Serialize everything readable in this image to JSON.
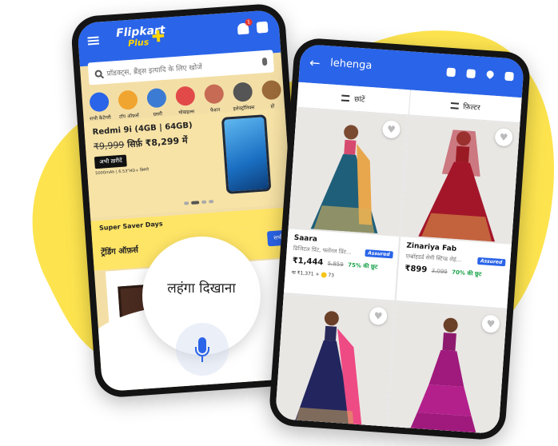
{
  "colors": {
    "brand_blue": "#2a64e8",
    "yellow_blob": "#fde44f",
    "discount_green": "#1aa34a"
  },
  "left_phone": {
    "logo": {
      "line1": "Flipkart",
      "line2": "Plus"
    },
    "search_placeholder": "प्रॉडक्ट्स, ब्रैंड्स इत्यादि के लिए खोजें",
    "categories": [
      {
        "label": "सभी कैटेगरी",
        "color": "#2a64e8"
      },
      {
        "label": "टॉप ऑफ़र्स",
        "color": "#f0a531"
      },
      {
        "label": "ग्रसरी",
        "color": "#3b7bd4"
      },
      {
        "label": "मोबाइल्स",
        "color": "#e24a4a"
      },
      {
        "label": "फैशन",
        "color": "#c76b55"
      },
      {
        "label": "इलेक्ट्रॉनिक्स",
        "color": "#555555"
      },
      {
        "label": "हो",
        "color": "#9b6a3a"
      }
    ],
    "promo": {
      "product": "Redmi 9i (4GB | 64GB)",
      "old_price": "₹9,999",
      "offer_text": "सिर्फ़ ₹8,299 में",
      "buy_label": "अभी ख़रीदें",
      "spec": "5000mAh | 6.53\"HD+ डिस्प्ले"
    },
    "saver_label": "Super Saver Days",
    "trending_label": "ट्रेंडिंग ऑफ़र्स",
    "view_all_label": "सभी देखें",
    "voice_query": "लहंगा दिखाना"
  },
  "right_phone": {
    "query": "lehenga",
    "sort_label": "छांटें",
    "filter_label": "फ़िल्टर",
    "products": [
      {
        "brand": "Saara",
        "title": "डिजिटल प्रिंट, फ्लोरल प्रिंट...",
        "price": "₹1,444",
        "mrp": "5,859",
        "discount": "75% की छूट",
        "extra": "या ₹1,371 +",
        "coins": "73",
        "assured": "Assured"
      },
      {
        "brand": "Zinariya Fab",
        "title": "एम्ब्रॉइडर्ड सेमी स्टिच्ड लेहं...",
        "price": "₹899",
        "mrp": "3,099",
        "discount": "70% की छूट",
        "assured": "Assured"
      },
      {
        "brand": "",
        "title": ""
      },
      {
        "brand": "",
        "title": ""
      }
    ]
  }
}
